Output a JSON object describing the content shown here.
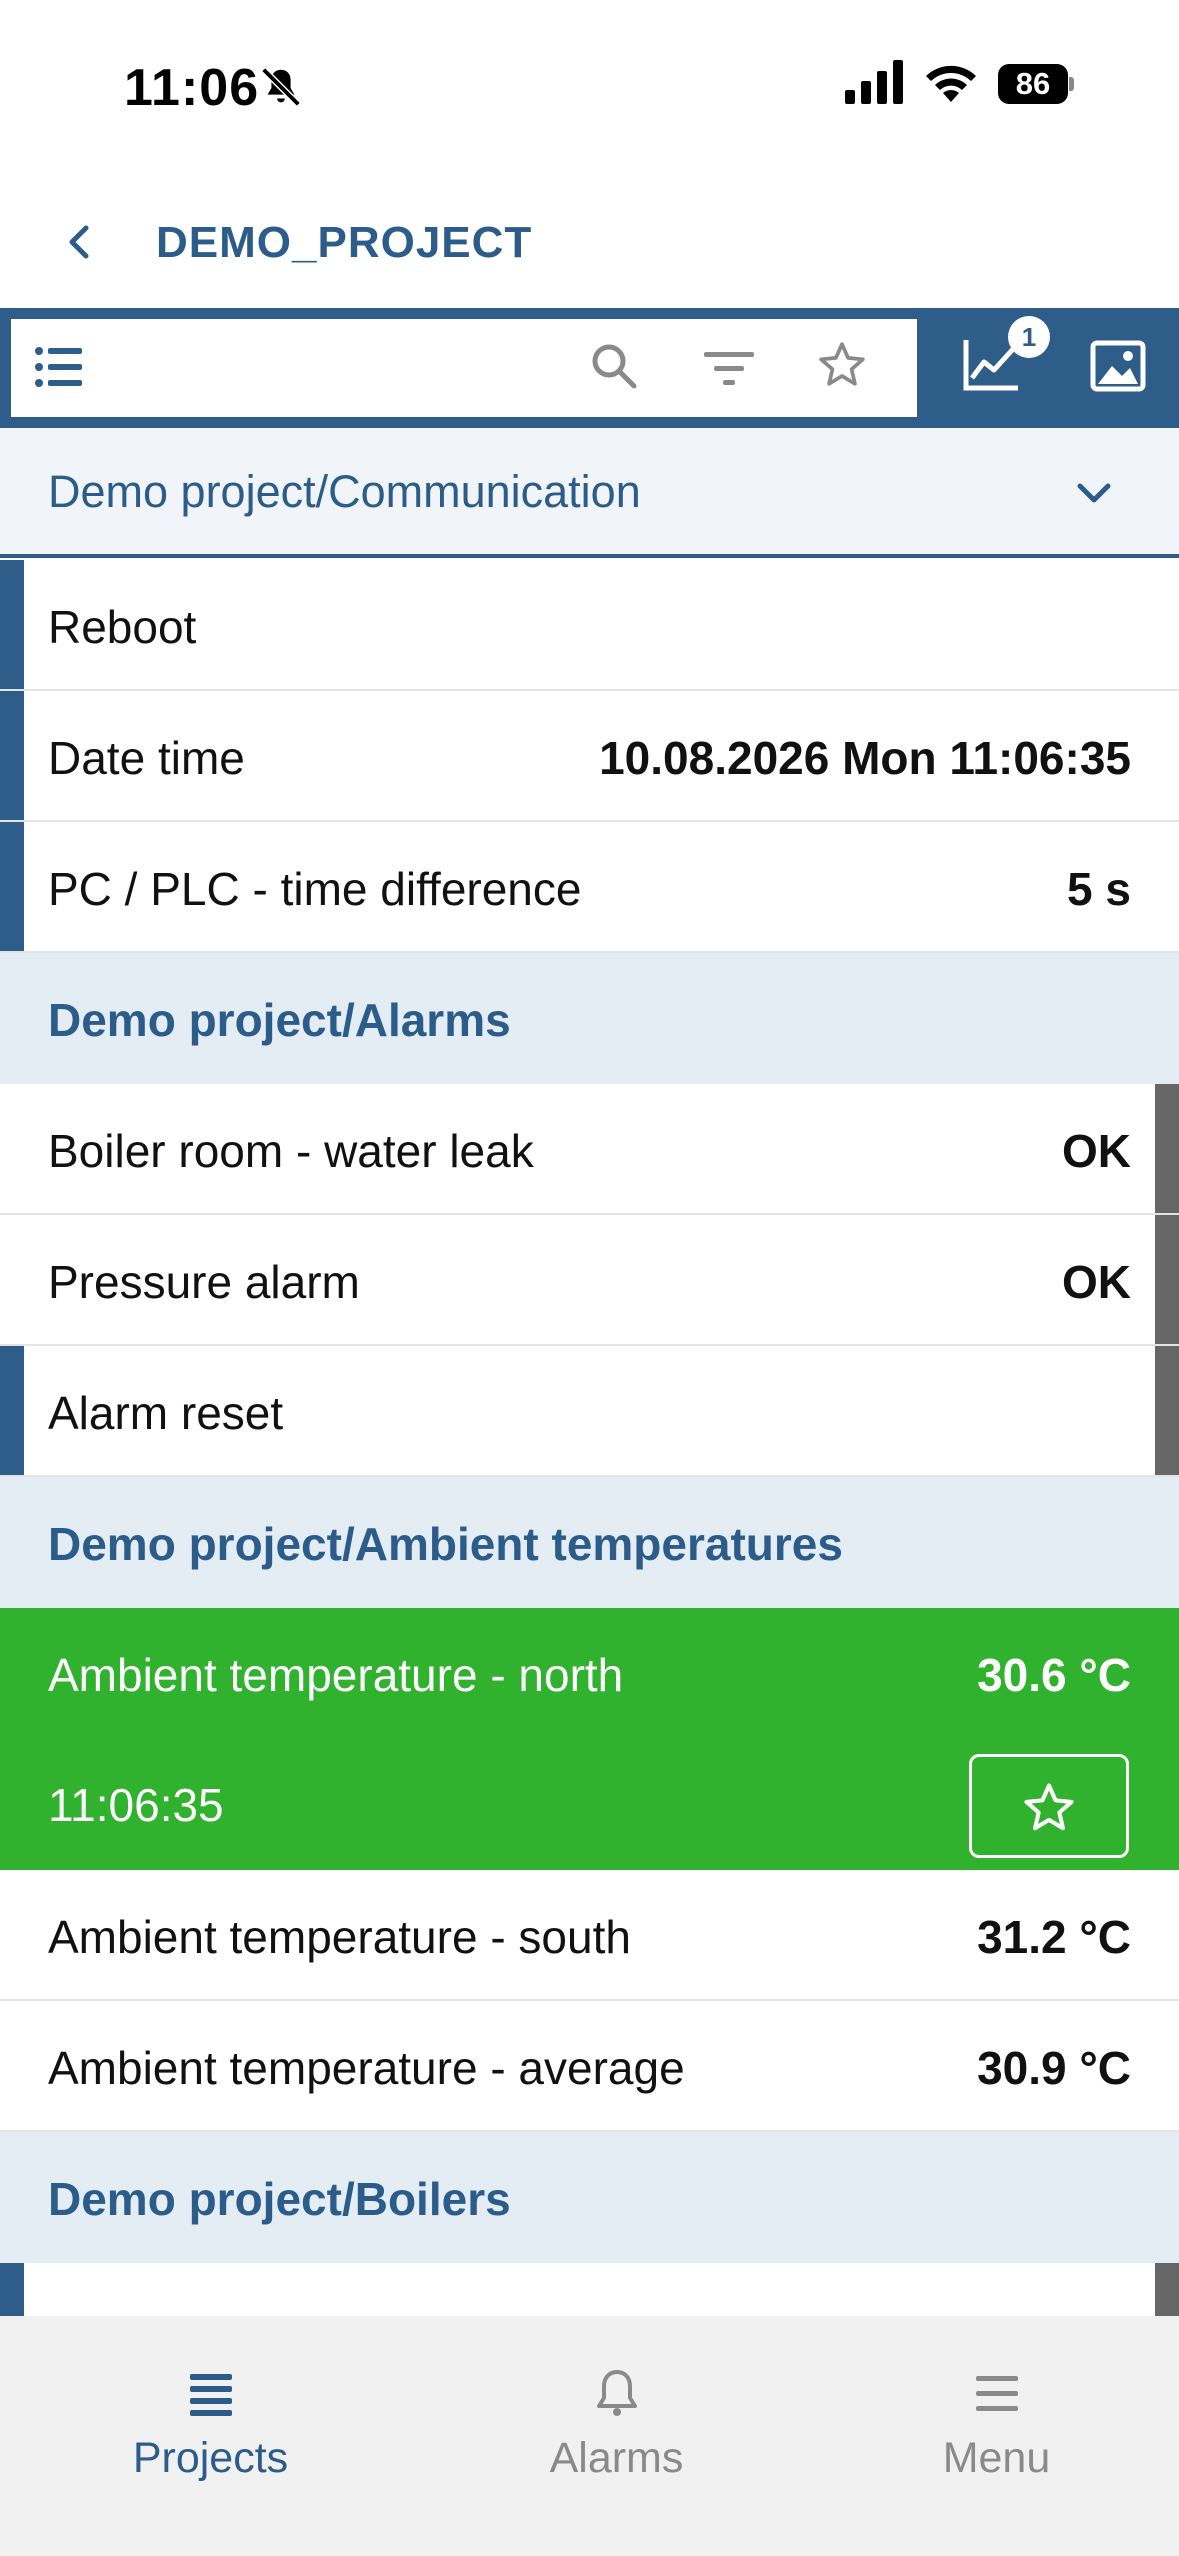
{
  "status": {
    "time": "11:06",
    "battery": "86"
  },
  "nav": {
    "title": "DEMO_PROJECT"
  },
  "toolbar": {
    "chart_badge": "1"
  },
  "group_select": {
    "label": "Demo project/Communication"
  },
  "communication": [
    {
      "name": "Reboot",
      "value": ""
    },
    {
      "name": "Date time",
      "value": "10.08.2026 Mon 11:06:35"
    },
    {
      "name": "PC / PLC - time difference",
      "value": "5 s"
    }
  ],
  "alarms": {
    "title": "Demo project/Alarms",
    "items": [
      {
        "name": "Boiler room - water leak",
        "value": "OK"
      },
      {
        "name": "Pressure alarm",
        "value": "OK"
      },
      {
        "name": "Alarm reset",
        "value": ""
      }
    ]
  },
  "ambient": {
    "title": "Demo project/Ambient temperatures",
    "selected": {
      "name": "Ambient temperature - north",
      "value": "30.6 °C",
      "time": "11:06:35"
    },
    "items": [
      {
        "name": "Ambient temperature - south",
        "value": "31.2 °C"
      },
      {
        "name": "Ambient temperature - average",
        "value": "30.9 °C"
      }
    ]
  },
  "boilers": {
    "title": "Demo project/Boilers"
  },
  "tabs": [
    {
      "label": "Projects",
      "icon": "list-icon",
      "active": true,
      "color": "#2c5d8a"
    },
    {
      "label": "Alarms",
      "icon": "bell-icon",
      "active": false,
      "color": "#8a8a8a"
    },
    {
      "label": "Menu",
      "icon": "menu-icon",
      "active": false,
      "color": "#8a8a8a"
    }
  ],
  "colors": {
    "primary": "#2e5d8a",
    "selected": "#31b22f",
    "section_bg": "#e4ecf4"
  }
}
